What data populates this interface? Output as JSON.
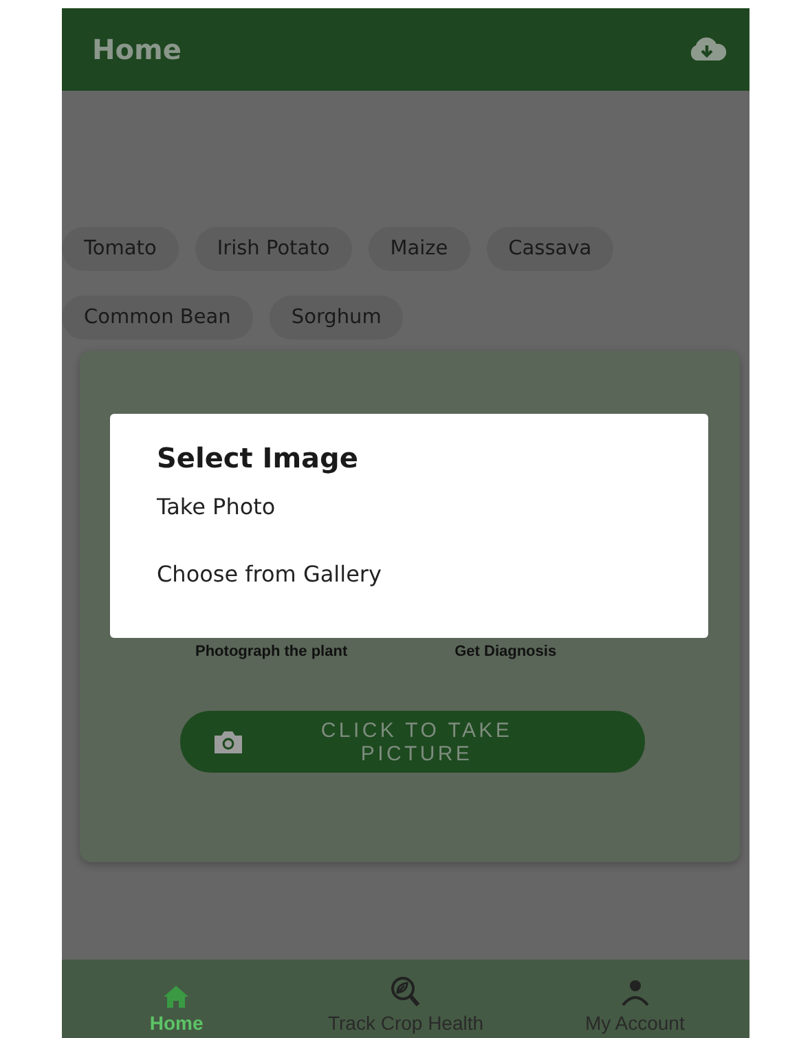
{
  "app_bar": {
    "title": "Home"
  },
  "crops": [
    {
      "label": "Tomato"
    },
    {
      "label": "Irish Potato"
    },
    {
      "label": "Maize"
    },
    {
      "label": "Cassava"
    },
    {
      "label": "Common Bean"
    },
    {
      "label": "Sorghum"
    }
  ],
  "card": {
    "steps": [
      "Photograph the plant",
      "Get Diagnosis"
    ],
    "button": "CLICK TO TAKE PICTURE"
  },
  "dialog": {
    "title": "Select Image",
    "options": [
      "Take Photo",
      "Choose from Gallery"
    ]
  },
  "bottom_nav": [
    {
      "label": "Home",
      "kind": "home",
      "selected": true
    },
    {
      "label": "Track Crop Health",
      "kind": "health",
      "selected": false
    },
    {
      "label": "My Account",
      "kind": "account",
      "selected": false
    }
  ]
}
